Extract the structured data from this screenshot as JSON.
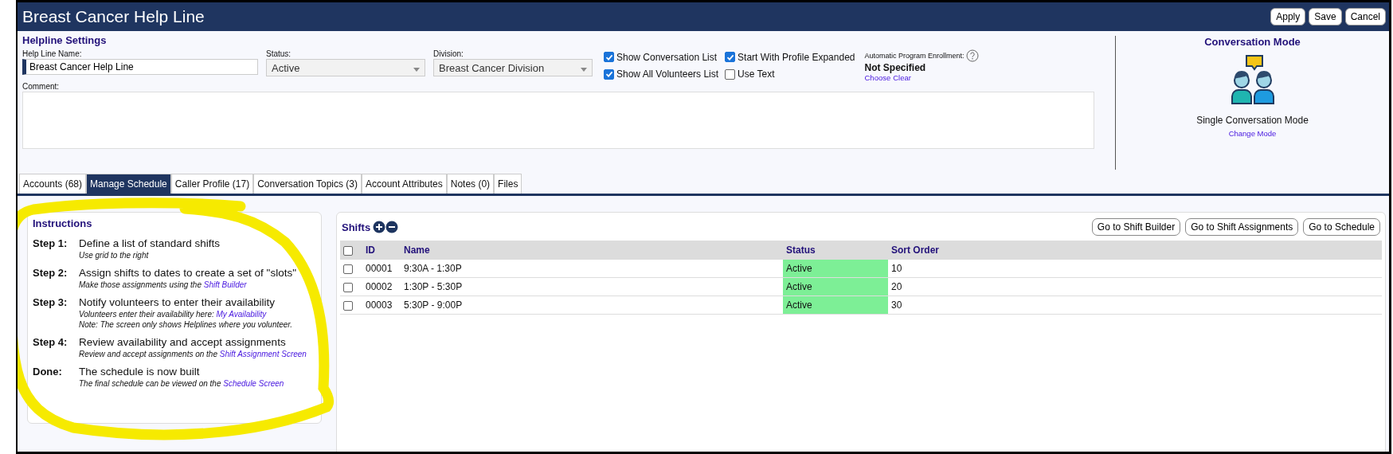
{
  "window": {
    "title": "Breast Cancer Help Line",
    "buttons": [
      "Apply",
      "Save",
      "Cancel"
    ]
  },
  "settings": {
    "heading": "Helpline Settings",
    "fields": [
      {
        "kind": "text",
        "label": "Help Line Name:",
        "value": "Breast Cancer Help Line"
      },
      {
        "kind": "select",
        "label": "Status:",
        "value": "Active"
      },
      {
        "kind": "select",
        "label": "Division:",
        "value": "Breast Cancer Division"
      }
    ],
    "checkboxes": [
      {
        "label": "Show Conversation List",
        "checked": true
      },
      {
        "label": "Show All Volunteers List",
        "checked": true
      },
      {
        "label": "Start With Profile Expanded",
        "checked": true
      },
      {
        "label": "Use Text",
        "checked": false
      }
    ],
    "enrollment": {
      "label": "Automatic Program Enrollment:",
      "value": "Not Specified",
      "links": [
        "Choose",
        "Clear"
      ]
    },
    "comment": {
      "label": "Comment:"
    }
  },
  "conversation_mode": {
    "heading": "Conversation Mode",
    "mode": "Single Conversation Mode",
    "link": "Change Mode"
  },
  "tabs": [
    {
      "label": "Accounts (68)",
      "selected": false
    },
    {
      "label": "Manage Schedule",
      "selected": true
    },
    {
      "label": "Caller Profile (17)",
      "selected": false
    },
    {
      "label": "Conversation Topics (3)",
      "selected": false
    },
    {
      "label": "Account Attributes",
      "selected": false
    },
    {
      "label": "Notes (0)",
      "selected": false
    },
    {
      "label": "Files",
      "selected": false
    }
  ],
  "instructions": {
    "heading": "Instructions",
    "steps": [
      {
        "label": "Step 1:",
        "title": "Define a list of standard shifts",
        "notes": [
          {
            "text": "Use grid to the right"
          }
        ]
      },
      {
        "label": "Step 2:",
        "title": "Assign shifts to dates to create a set of \"slots\"",
        "notes": [
          {
            "text": "Make those assignments using the ",
            "link": "Shift Builder"
          }
        ]
      },
      {
        "label": "Step 3:",
        "title": "Notify volunteers to enter their availability",
        "notes": [
          {
            "text": "Volunteers enter their availability here: ",
            "link": "My Availability"
          },
          {
            "text": "Note: The screen only shows Helplines where you volunteer."
          }
        ]
      },
      {
        "label": "Step 4:",
        "title": "Review availability and accept assignments",
        "notes": [
          {
            "text": "Review and accept assignments on the ",
            "link": "Shift Assignment Screen"
          }
        ]
      },
      {
        "label": "Done:",
        "title": "The schedule is now built",
        "notes": [
          {
            "text": "The final schedule can be viewed on the ",
            "link": "Schedule Screen"
          }
        ]
      }
    ]
  },
  "shifts": {
    "heading": "Shifts",
    "buttons": [
      "Go to Shift Builder",
      "Go to Shift Assignments",
      "Go to Schedule"
    ],
    "select_all": false,
    "columns": [
      "ID",
      "Name",
      "Status",
      "Sort Order"
    ],
    "rows": [
      {
        "selected": false,
        "id": "00001",
        "name": "9:30A - 1:30P",
        "status": "Active",
        "color": "#7def96",
        "sort_order": "10"
      },
      {
        "selected": false,
        "id": "00002",
        "name": "1:30P - 5:30P",
        "status": "Active",
        "color": "#7def96",
        "sort_order": "20"
      },
      {
        "selected": false,
        "id": "00003",
        "name": "5:30P - 9:00P",
        "status": "Active",
        "color": "#7def96",
        "sort_order": "30"
      }
    ]
  }
}
